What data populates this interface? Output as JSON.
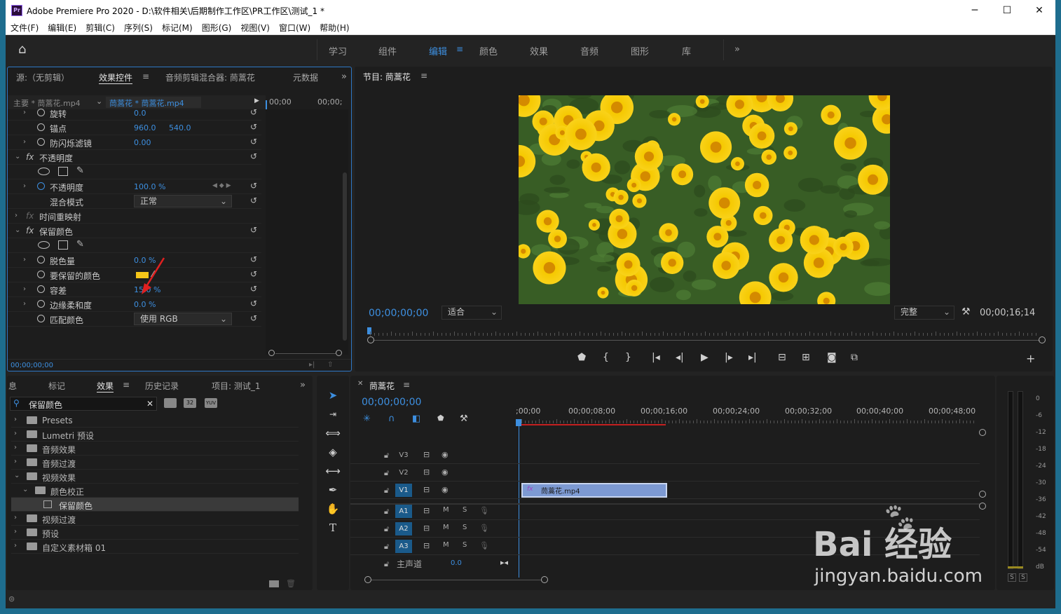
{
  "window": {
    "title": "Adobe Premiere Pro 2020 - D:\\软件相关\\后期制作工作区\\PR工作区\\测试_1 *",
    "app_icon": "Pr"
  },
  "menu": [
    "文件(F)",
    "编辑(E)",
    "剪辑(C)",
    "序列(S)",
    "标记(M)",
    "图形(G)",
    "视图(V)",
    "窗口(W)",
    "帮助(H)"
  ],
  "workspaces": {
    "items": [
      "学习",
      "组件",
      "编辑",
      "颜色",
      "效果",
      "音频",
      "图形",
      "库"
    ],
    "active": "编辑",
    "more": "»"
  },
  "effect_controls": {
    "tabs": [
      "源:（无剪辑）",
      "效果控件",
      "音频剪辑混合器: 茼蒿花",
      "元数据"
    ],
    "active_tab": "效果控件",
    "master": "主要 * 茼蒿花.mp4",
    "clip": "茼蒿花 * 茼蒿花.mp4",
    "tl_times": [
      "00;00",
      "00;00;"
    ],
    "rows": [
      {
        "label": "旋转",
        "value": "0.0"
      },
      {
        "label": "锚点",
        "value": "960.0",
        "value2": "540.0"
      },
      {
        "label": "防闪烁滤镜",
        "value": "0.00"
      },
      {
        "label": "不透明度"
      },
      {
        "label": "不透明度",
        "value": "100.0 %"
      },
      {
        "label": "混合模式",
        "value": "正常"
      },
      {
        "label": "时间重映射"
      },
      {
        "label": "保留颜色"
      },
      {
        "label": "脱色量",
        "value": "0.0 %"
      },
      {
        "label": "要保留的颜色"
      },
      {
        "label": "容差",
        "value": "15.0 %"
      },
      {
        "label": "边缘柔和度",
        "value": "0.0 %"
      },
      {
        "label": "匹配颜色",
        "value": "使用 RGB"
      }
    ],
    "timecode": "00;00;00;00",
    "keep_color": "#f5c518",
    "accent": "#3d8fe0",
    "arrow_color": "#e02020"
  },
  "program": {
    "title": "节目: 茼蒿花",
    "timecode": "00;00;00;00",
    "fit": "适合",
    "quality": "完整",
    "duration": "00;00;16;14"
  },
  "effects_panel": {
    "tabs": [
      "息",
      "标记",
      "效果",
      "历史记录",
      "项目: 测试_1"
    ],
    "active_tab": "效果",
    "search": "保留颜色",
    "badges": [
      "32",
      "YUV"
    ],
    "tree": [
      {
        "name": "Presets"
      },
      {
        "name": "Lumetri 预设"
      },
      {
        "name": "音频效果"
      },
      {
        "name": "音频过渡"
      },
      {
        "name": "视频效果"
      },
      {
        "name": "颜色校正"
      },
      {
        "name": "保留颜色"
      },
      {
        "name": "视频过渡"
      },
      {
        "name": "预设"
      },
      {
        "name": "自定义素材箱 01"
      }
    ]
  },
  "timeline": {
    "title": "茼蒿花",
    "timecode": "00;00;00;00",
    "ruler": [
      ";00;00",
      "00;00;08;00",
      "00;00;16;00",
      "00;00;24;00",
      "00;00;32;00",
      "00;00;40;00",
      "00;00;48;00"
    ],
    "tracks": [
      {
        "name": "V3"
      },
      {
        "name": "V2"
      },
      {
        "name": "V1"
      },
      {
        "name": "A1"
      },
      {
        "name": "A2"
      },
      {
        "name": "A3"
      }
    ],
    "track_m": "M",
    "track_s": "S",
    "master_track": "主声道",
    "master_value": "0.0",
    "clip": "茼蒿花.mp4",
    "clip_fx": "fx"
  },
  "meter": {
    "scale": [
      "0",
      "-6",
      "-12",
      "-18",
      "-24",
      "-30",
      "-36",
      "-42",
      "-48",
      "-54",
      "dB"
    ],
    "solo": "S"
  },
  "watermark": {
    "text": "Bai 经验",
    "url": "jingyan.baidu.com"
  }
}
